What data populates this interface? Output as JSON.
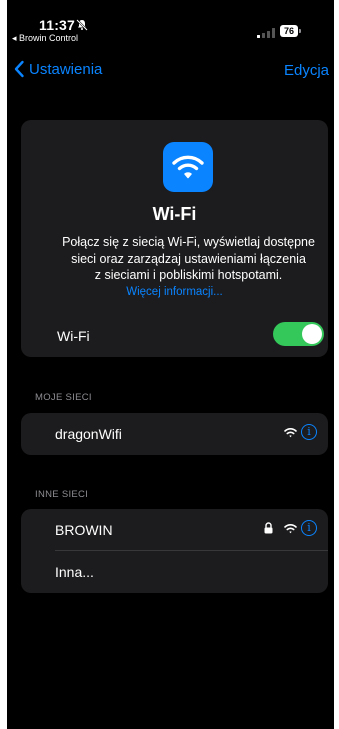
{
  "status_bar": {
    "time": "11:37",
    "back_app": "◂ Browin Control",
    "battery": "76",
    "icons": [
      "bell-slash-icon",
      "signal-icon",
      "battery-icon"
    ]
  },
  "nav": {
    "back_label": "Ustawienia",
    "edit_label": "Edycja"
  },
  "header_card": {
    "icon": "wifi-app-icon",
    "title": "Wi-Fi",
    "description_lines": [
      "Połącz się z siecią Wi-Fi, wyświetlaj dostępne",
      "sieci oraz zarządzaj ustawieniami łączenia",
      "z sieciami i pobliskimi hotspotami."
    ],
    "more_link": "Więcej informacji...",
    "wifi_label": "Wi-Fi",
    "wifi_enabled": true
  },
  "my_networks": {
    "header": "MOJE SIECI",
    "items": [
      {
        "name": "dragonWifi",
        "locked": false,
        "icons": [
          "wifi-icon",
          "info-icon"
        ]
      }
    ]
  },
  "other_networks": {
    "header": "INNE SIECI",
    "items": [
      {
        "name": "BROWIN",
        "locked": true,
        "icons": [
          "lock-icon",
          "wifi-icon",
          "info-icon"
        ]
      },
      {
        "name": "Inna..."
      }
    ]
  },
  "colors": {
    "accent": "#0a84ff",
    "toggle_on": "#34c759",
    "background": "#000000",
    "card": "#1c1c1e",
    "secondary_text": "#8e8e93"
  }
}
